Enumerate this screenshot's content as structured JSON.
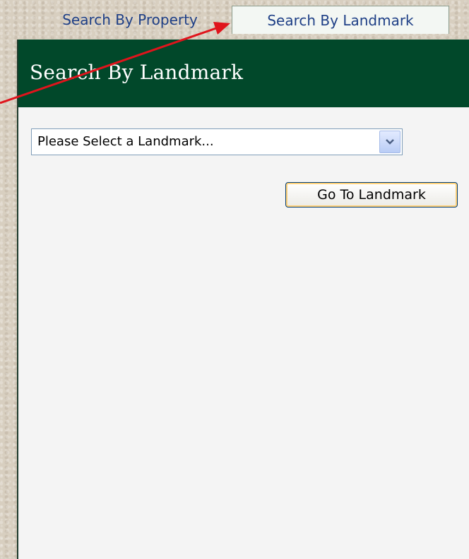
{
  "tabs": [
    {
      "label": "Search By Property",
      "active": false
    },
    {
      "label": "Search By Landmark",
      "active": true
    }
  ],
  "panel": {
    "title": "Search By Landmark"
  },
  "landmark_select": {
    "selected": "Please Select a Landmark..."
  },
  "go_button": {
    "label": "Go To Landmark"
  },
  "colors": {
    "header_bg": "#01482a",
    "tab_text": "#1e3f86",
    "annotation_arrow": "#e0141c"
  }
}
